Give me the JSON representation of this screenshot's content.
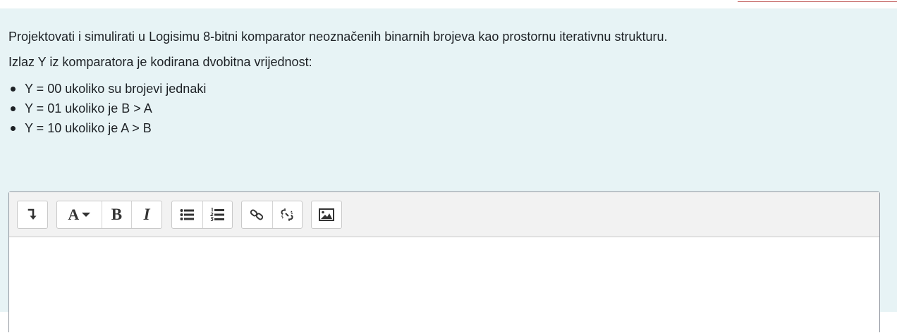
{
  "question": {
    "paragraph1": "Projektovati i simulirati u Logisimu 8-bitni komparator neoznačenih binarnih brojeva kao prostornu iterativnu strukturu.",
    "paragraph2": "Izlaz Y iz komparatora je kodirana dvobitna vrijednost:",
    "bullets": [
      "Y = 00 ukoliko su brojevi jednaki",
      "Y = 01 ukoliko je B > A",
      "Y = 10 ukoliko je A > B"
    ]
  },
  "editor": {
    "toolbar": {
      "buttons": [
        {
          "name": "show-more-buttons",
          "icon": "arrow-down-return-icon"
        },
        {
          "name": "paragraph-format",
          "label": "A",
          "icon": "caret-down-icon"
        },
        {
          "name": "bold",
          "label": "B"
        },
        {
          "name": "italic",
          "label": "I"
        },
        {
          "name": "unordered-list",
          "icon": "bullet-list-icon"
        },
        {
          "name": "ordered-list",
          "icon": "numbered-list-icon"
        },
        {
          "name": "link",
          "icon": "link-icon"
        },
        {
          "name": "unlink",
          "icon": "unlink-icon"
        },
        {
          "name": "insert-image",
          "icon": "image-icon"
        }
      ]
    },
    "content": ""
  },
  "colors": {
    "panel_background": "#e7f3f5",
    "text": "#1d2125",
    "toolbar_background": "#f2f2f2"
  }
}
